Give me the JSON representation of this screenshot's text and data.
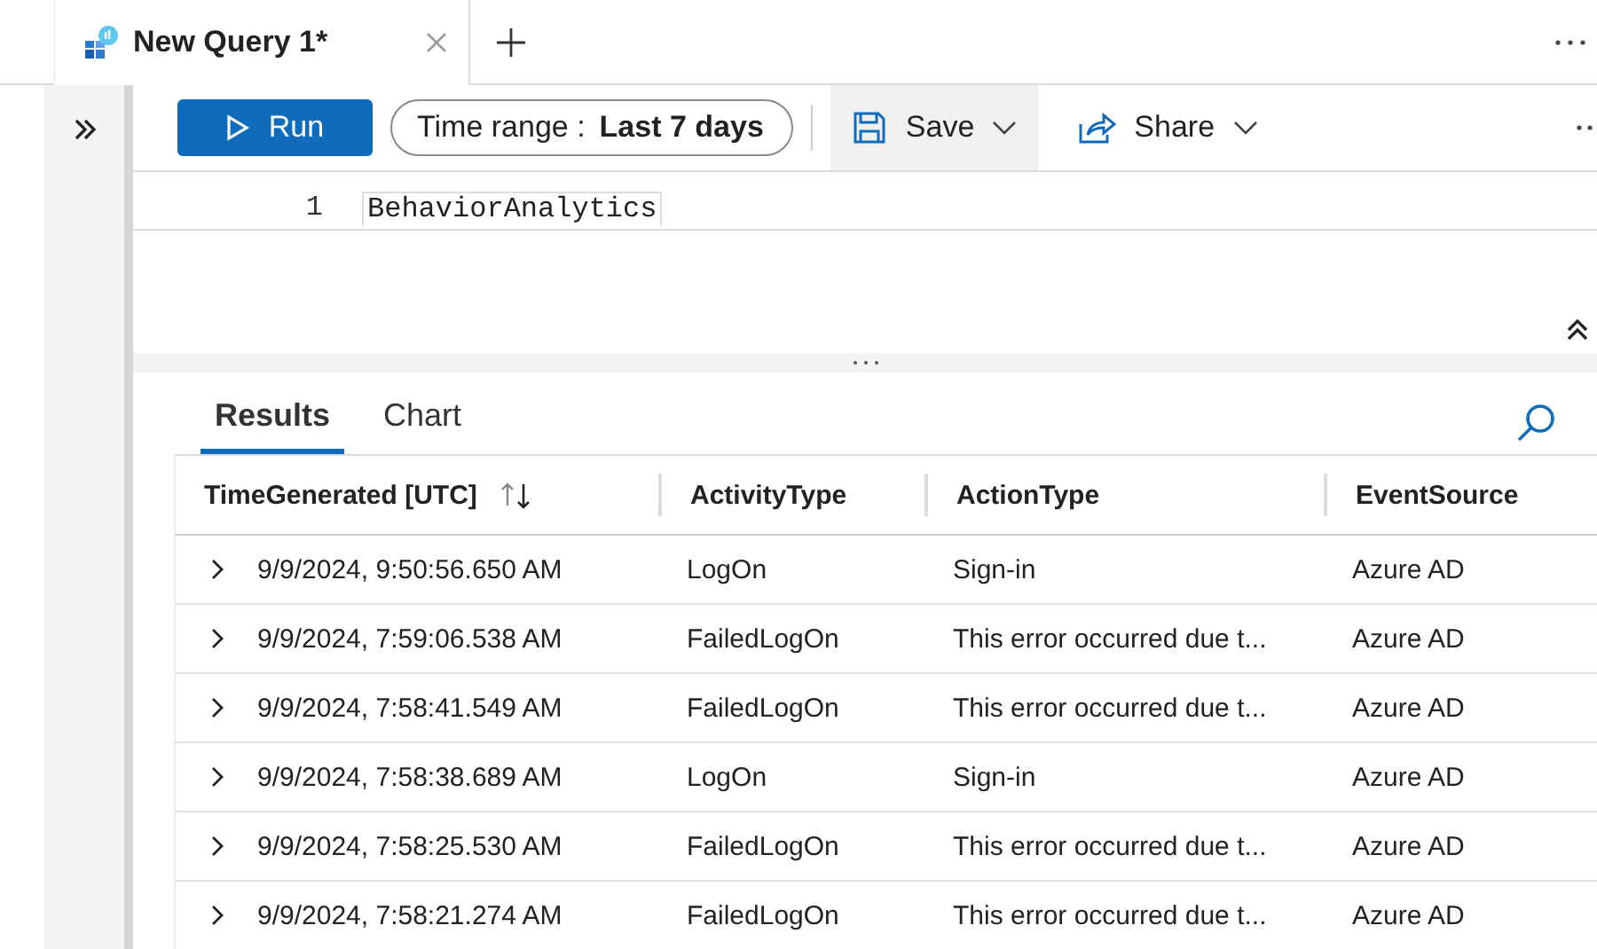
{
  "tabs": [
    {
      "label": "New Query 1*",
      "selected": true
    }
  ],
  "toolbar": {
    "run": "Run",
    "time_range": {
      "label": "Time range :",
      "value": "Last 7 days"
    },
    "save": "Save",
    "share": "Share"
  },
  "editor": {
    "lines": [
      {
        "number": "1",
        "code": "BehaviorAnalytics"
      }
    ]
  },
  "results_tabs": [
    {
      "label": "Results",
      "selected": true
    },
    {
      "label": "Chart",
      "selected": false
    }
  ],
  "table": {
    "columns": [
      "TimeGenerated [UTC]",
      "ActivityType",
      "ActionType",
      "EventSource"
    ],
    "rows": [
      {
        "cells": [
          "9/9/2024, 9:50:56.650 AM",
          "LogOn",
          "Sign-in",
          "Azure AD"
        ]
      },
      {
        "cells": [
          "9/9/2024, 7:59:06.538 AM",
          "FailedLogOn",
          "This error occurred due t...",
          "Azure AD"
        ]
      },
      {
        "cells": [
          "9/9/2024, 7:58:41.549 AM",
          "FailedLogOn",
          "This error occurred due t...",
          "Azure AD"
        ]
      },
      {
        "cells": [
          "9/9/2024, 7:58:38.689 AM",
          "LogOn",
          "Sign-in",
          "Azure AD"
        ]
      },
      {
        "cells": [
          "9/9/2024, 7:58:25.530 AM",
          "FailedLogOn",
          "This error occurred due t...",
          "Azure AD"
        ]
      },
      {
        "cells": [
          "9/9/2024, 7:58:21.274 AM",
          "FailedLogOn",
          "This error occurred due t...",
          "Azure AD"
        ]
      }
    ]
  }
}
